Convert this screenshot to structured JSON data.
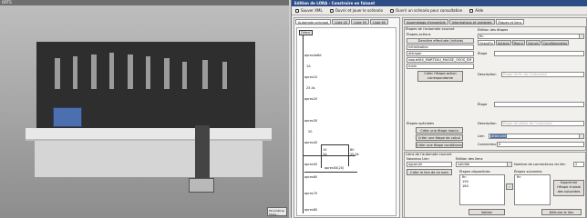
{
  "scene": {
    "window_title": "ORTS",
    "badge_label": "Paramètres",
    "badge_sub": "Mode..."
  },
  "editor": {
    "window_title": "Edition de LORA - Construire en faisant",
    "toolbar": {
      "save_label": "Sauver XML",
      "open_play_label": "Ouvrir et jouer le scénario",
      "open_consult_label": "Ouvrir un scénario pour consultation",
      "help_label": "Aide"
    },
    "left_tabs": [
      {
        "label": "Automate principal",
        "active": true
      },
      {
        "label": "Liste 20",
        "active": false
      },
      {
        "label": "Liste 55",
        "active": false
      },
      {
        "label": "Liste 60",
        "active": false
      }
    ],
    "graph_nodes": [
      "Début",
      "apres4a6d",
      "apres10",
      "apres20",
      "apres30",
      "apres40",
      "apres50",
      "apres60",
      "apres70",
      "apres80",
      "1A",
      "25.0s",
      "10",
      "3A",
      "80",
      "25.0s",
      "20",
      "apres50(20)"
    ],
    "right_tabs": [
      {
        "label": "Assemblage d'ensemble",
        "active": false
      },
      {
        "label": "Informations et variables",
        "active": false
      },
      {
        "label": "Étapes et liens",
        "active": true
      }
    ],
    "current_step": {
      "section_title": "Étapes de l'automate courant",
      "actions_label": "Étapes-actions",
      "last_action_label": "Dernière effectuée (initiale)",
      "action_fields": [
        "initialisation",
        "attraper",
        "saqueSt4_MARTEAU_MASSE_OSOS_EM",
        "main"
      ],
      "create_action_button": "Créer l'étape-action correspondante",
      "special_title": "Étapes spéciales",
      "macro_button": "Créer une étape macro",
      "calc_button": "Créer une étape de calcul",
      "cond_button": "Créer une étape conditionnelle"
    },
    "step_edit": {
      "title": "Édition des étapes",
      "step_value": "fin",
      "mini_tabs": [
        {
          "label": "DebutFin",
          "active": true
        },
        {
          "label": "Actions",
          "active": false
        },
        {
          "label": "Macro",
          "active": false
        },
        {
          "label": "Calculs",
          "active": false
        },
        {
          "label": "Conditionnelles",
          "active": false
        }
      ],
      "etape_label": "Étape",
      "description_label": "Description",
      "description_placeholder": "Étape de fin de l'automate",
      "etape2_label": "Étape",
      "description2_label": "Description",
      "description2_placeholder": "Étape de début de l'automate",
      "lien_label": "Lien",
      "lien_value": "atteindre",
      "connecteur_label": "Connecteur",
      "connecteur_value": "0"
    },
    "links": {
      "title": "Liens de l'automate courant",
      "new_link_label": "Nouveau Lien",
      "new_link_value": "agrandir",
      "create_link_button": "Créer le lien de ce nom",
      "edit_title": "Édition des liens",
      "edit_value": "validite",
      "connector_count_label": "Nombre de connecteurs du lien",
      "connector_count_value": "2",
      "available_label": "Étapes disponibles",
      "available_items": [
        "fin",
        "190",
        "180"
      ],
      "following_label": "Étapes suivantes",
      "following_items": [
        "fin"
      ],
      "delete_step_button": "Supprimer l'étape choisie des suivantes",
      "validate_button": "Valider",
      "delete_link_button": "Détruire le lien"
    }
  }
}
